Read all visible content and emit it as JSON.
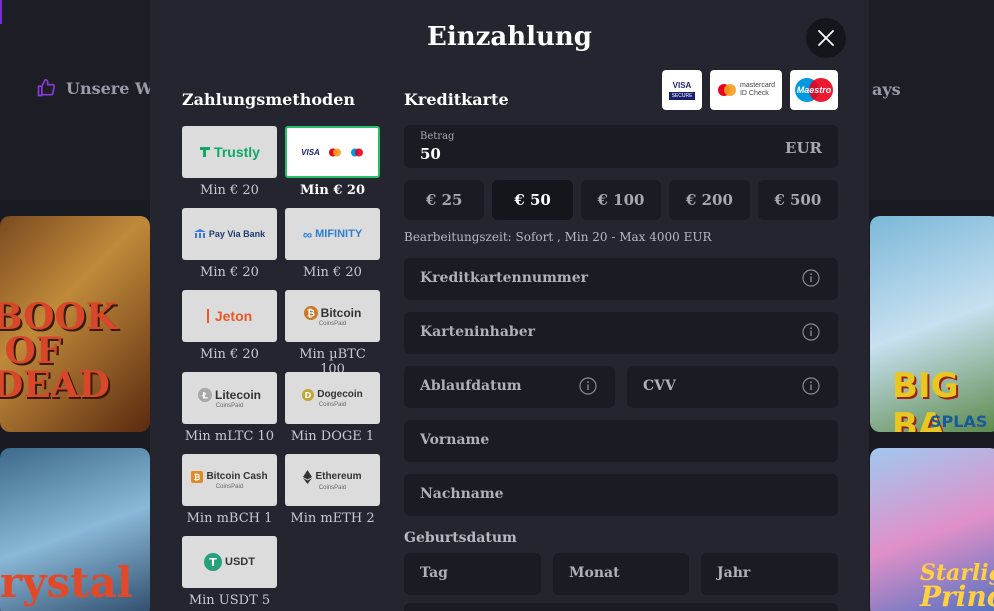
{
  "background": {
    "nav_left_label": "Unsere Wa",
    "nav_right_label": "ays",
    "tiles": [
      {
        "title": "BOOK\nOF\nDEAD"
      },
      {
        "title": "rystal"
      },
      {
        "title": "BIG BA",
        "subtitle": "SPLAS"
      },
      {
        "title": "Starlig",
        "subtitle": "Princ"
      }
    ]
  },
  "modal": {
    "title": "Einzahlung",
    "payment_methods_title": "Zahlungsmethoden",
    "methods": [
      {
        "name": "Trustly",
        "min": "Min € 20",
        "selected": false
      },
      {
        "name": "VISA",
        "min": "Min € 20",
        "selected": true
      },
      {
        "name": "Pay Via Bank",
        "min": "Min € 20",
        "selected": false
      },
      {
        "name": "MIFINITY",
        "min": "Min € 20",
        "selected": false
      },
      {
        "name": "Jeton",
        "min": "Min € 20",
        "selected": false
      },
      {
        "name": "Bitcoin",
        "sub": "CoinsPaid",
        "min": "Min µBTC 100",
        "selected": false
      },
      {
        "name": "Litecoin",
        "sub": "CoinsPaid",
        "min": "Min mLTC 10",
        "selected": false
      },
      {
        "name": "Dogecoin",
        "sub": "CoinsPaid",
        "min": "Min DOGE 1",
        "selected": false
      },
      {
        "name": "Bitcoin Cash",
        "sub": "CoinsPaid",
        "min": "Min mBCH 1",
        "selected": false
      },
      {
        "name": "Ethereum",
        "sub": "CoinsPaid",
        "min": "Min mETH 2",
        "selected": false
      },
      {
        "name": "USDT",
        "min": "Min USDT 5",
        "selected": false
      }
    ],
    "creditcard_title": "Kreditkarte",
    "card_logos": [
      {
        "name": "VISA",
        "sub": "SECURE"
      },
      {
        "name": "mastercard",
        "sub": "ID Check"
      },
      {
        "name": "Maestro"
      }
    ],
    "amount": {
      "label": "Betrag",
      "value": "50",
      "currency": "EUR"
    },
    "presets": [
      {
        "label": "€ 25",
        "active": false
      },
      {
        "label": "€ 50",
        "active": true
      },
      {
        "label": "€ 100",
        "active": false
      },
      {
        "label": "€ 200",
        "active": false
      },
      {
        "label": "€ 500",
        "active": false
      }
    ],
    "processing_time": "Bearbeitungszeit: Sofort , Min 20 - Max 4000 EUR",
    "fields": {
      "card_number": "Kreditkartennummer",
      "card_holder": "Karteninhaber",
      "expiry": "Ablaufdatum",
      "cvv": "CVV",
      "first_name": "Vorname",
      "last_name": "Nachname"
    },
    "dob": {
      "label": "Geburtsdatum",
      "day": "Tag",
      "month": "Monat",
      "year": "Jahr"
    }
  },
  "colors": {
    "modal_bg": "#25252f",
    "field_bg": "#1b1b23",
    "selected_border": "#27c06a",
    "accent_purple": "#7a2fd0"
  }
}
